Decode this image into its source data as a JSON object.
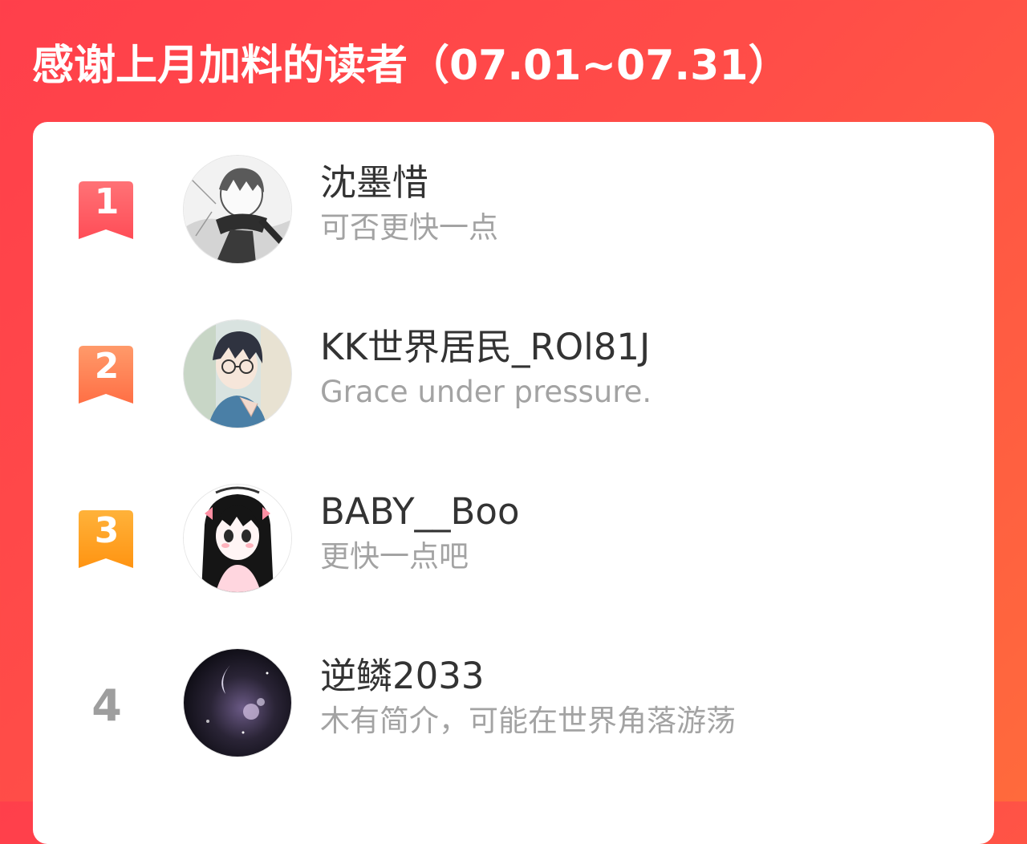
{
  "header": {
    "title": "感谢上月加料的读者（07.01~07.31）"
  },
  "colors": {
    "background": "#ff4548",
    "rank1": "#ff5a5f",
    "rank2": "#ff7a4a",
    "rank3": "#ffa01c",
    "rank_plain": "#9e9e9e",
    "name": "#333333",
    "desc": "#a3a3a3"
  },
  "readers": [
    {
      "rank": "1",
      "name": "沈墨惜",
      "desc": "可否更快一点",
      "avatar_icon": "anime-boy-scarf-avatar"
    },
    {
      "rank": "2",
      "name": "KK世界居民_ROl81J",
      "desc": "Grace under pressure.",
      "avatar_icon": "anime-boy-glasses-avatar"
    },
    {
      "rank": "3",
      "name": "BABY__Boo",
      "desc": "更快一点吧",
      "avatar_icon": "anime-girl-ribbons-avatar"
    },
    {
      "rank": "4",
      "name": "逆鳞2033",
      "desc": "木有简介，可能在世界角落游荡",
      "avatar_icon": "night-sky-avatar"
    }
  ]
}
